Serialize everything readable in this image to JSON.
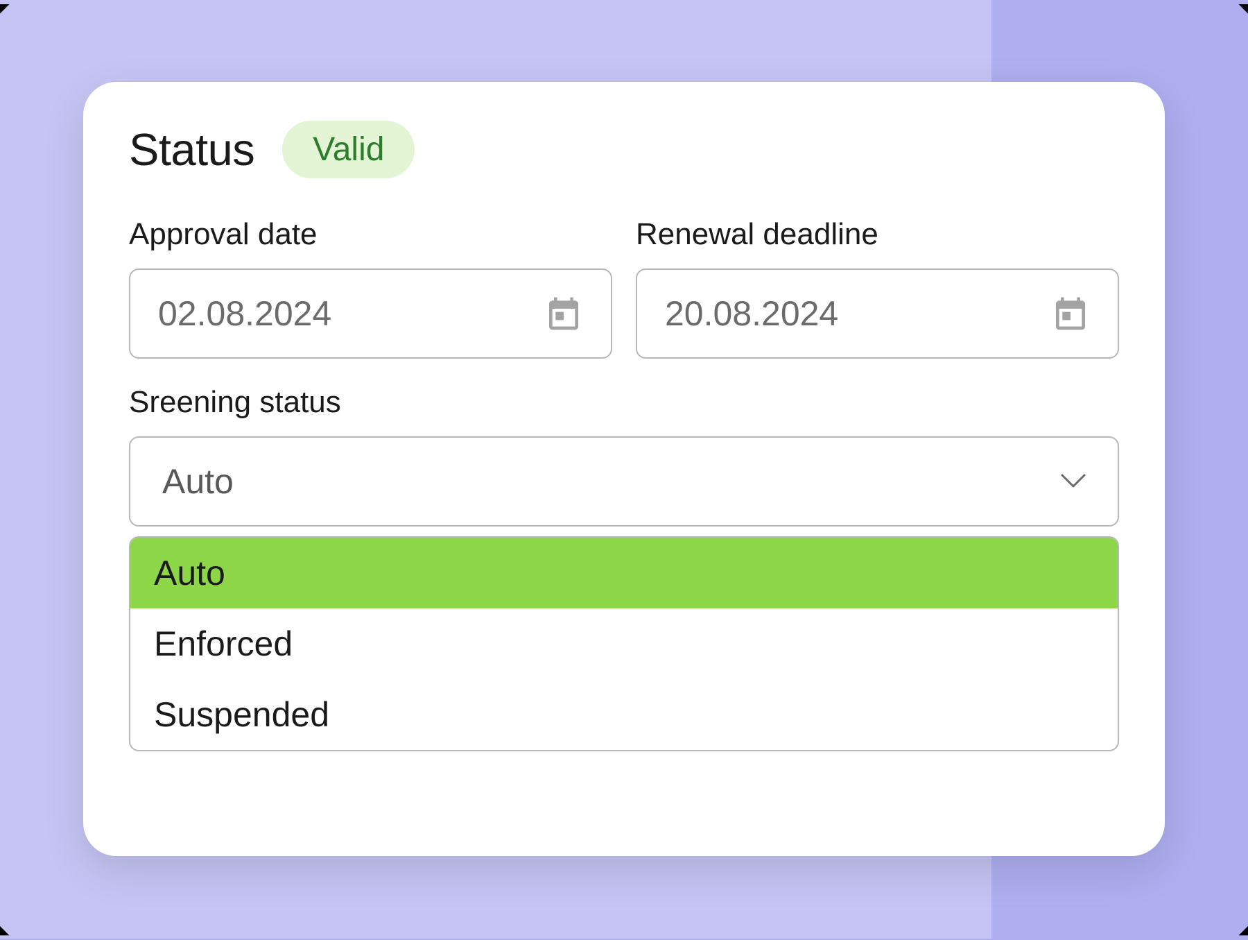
{
  "header": {
    "title": "Status",
    "badge": "Valid"
  },
  "fields": {
    "approval": {
      "label": "Approval date",
      "value": "02.08.2024"
    },
    "renewal": {
      "label": "Renewal deadline",
      "value": "20.08.2024"
    },
    "screening": {
      "label": "Sreening status",
      "selected": "Auto",
      "options": [
        "Auto",
        "Enforced",
        "Suspended"
      ]
    }
  },
  "colors": {
    "backdrop_outer": "#aeaef0",
    "backdrop_inner": "#c5c4f4",
    "card": "#ffffff",
    "badge_bg": "#e4f5d5",
    "badge_text": "#2d7d2d",
    "dropdown_selected": "#8cd648"
  }
}
